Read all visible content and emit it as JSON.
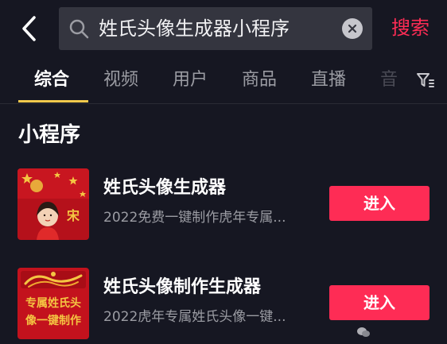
{
  "header": {
    "search_query": "姓氏头像生成器小程序",
    "search_button_label": "搜索"
  },
  "tabs": [
    {
      "label": "综合",
      "active": true
    },
    {
      "label": "视频",
      "active": false
    },
    {
      "label": "用户",
      "active": false
    },
    {
      "label": "商品",
      "active": false
    },
    {
      "label": "直播",
      "active": false
    },
    {
      "label": "音",
      "active": false
    }
  ],
  "section": {
    "title": "小程序"
  },
  "results": [
    {
      "title": "姓氏头像生成器",
      "description": "2022免费一键制作虎年专属...",
      "button_label": "进入",
      "thumb_text": "宋"
    },
    {
      "title": "姓氏头像制作生成器",
      "description": "2022虎年专属姓氏头像一键...",
      "button_label": "进入",
      "thumb_text": "专属姓氏头像一键制作"
    }
  ],
  "colors": {
    "accent": "#fe2c55",
    "tab_indicator": "#f2c94c",
    "background": "#161722"
  }
}
